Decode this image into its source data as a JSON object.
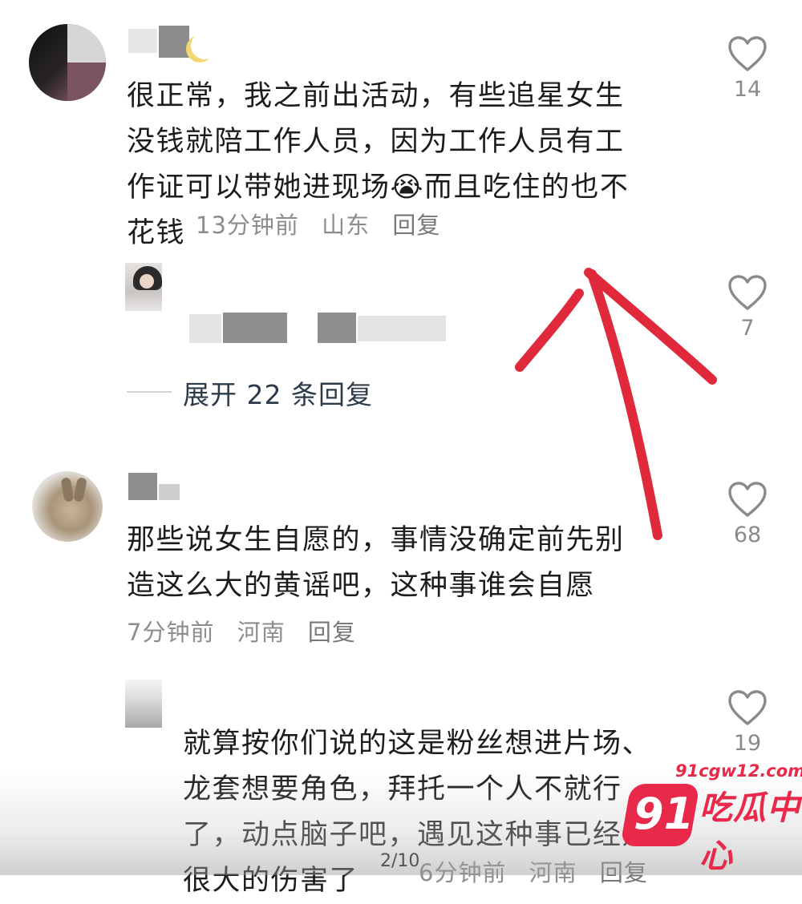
{
  "comments": [
    {
      "text": "很正常，我之前出活动，有些追星女生\n没钱就陪工作人员，因为工作人员有工\n作证可以带她进现场😭而且吃住的也不\n花钱",
      "time": "13分钟前",
      "location": "山东",
      "reply": "回复",
      "likes": "14"
    },
    {
      "likes": "7",
      "expand_label": "展开 22 条回复"
    },
    {
      "text": "那些说女生自愿的，事情没确定前先别\n造这么大的黄谣吧，这种事谁会自愿",
      "time": "7分钟前",
      "location": "河南",
      "reply": "回复",
      "likes": "68"
    },
    {
      "text": "就算按你们说的这是粉丝想进片场、\n龙套想要角色，拜托一个人不就行\n了，动点脑子吧，遇见这种事已经是\n很大的伤害了",
      "time": "6分钟前",
      "location": "河南",
      "reply": "回复",
      "likes": "19"
    }
  ],
  "watermark": {
    "url": "91cgw12.com",
    "badge": "91",
    "name": "吃瓜中心"
  },
  "page_indicator": "2/10",
  "colors": {
    "accent": "#e8294a",
    "arrow": "#e02a3c",
    "meta": "#8d8d8d"
  },
  "icons": {
    "like": "heart-outline-icon"
  }
}
